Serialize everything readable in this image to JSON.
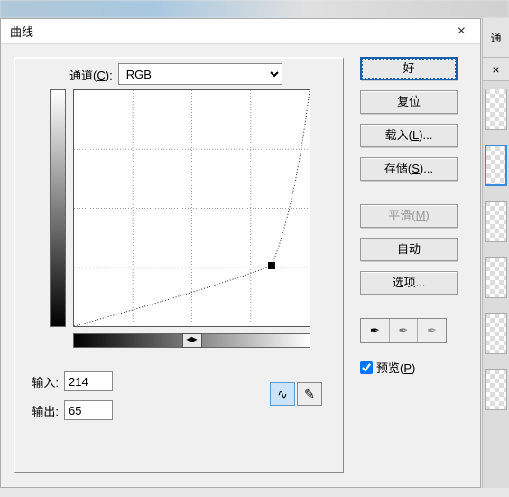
{
  "dialog": {
    "title": "曲线",
    "close_glyph": "×"
  },
  "channel": {
    "label_prefix": "通道(",
    "label_hotkey": "C",
    "label_suffix": "): ",
    "value": "RGB"
  },
  "chart_data": {
    "type": "line",
    "title": "",
    "xlabel": "输入",
    "ylabel": "输出",
    "xlim": [
      0,
      255
    ],
    "ylim": [
      0,
      255
    ],
    "points": [
      {
        "x": 0,
        "y": 0
      },
      {
        "x": 214,
        "y": 65
      },
      {
        "x": 255,
        "y": 255
      }
    ],
    "selected_point_index": 1,
    "grid_divisions": 4
  },
  "io": {
    "input_label": "输入:",
    "input_value": "214",
    "output_label": "输出:",
    "output_value": "65"
  },
  "mode": {
    "curve_glyph": "∿",
    "pencil_glyph": "✎"
  },
  "buttons": {
    "ok": "好",
    "reset": "复位",
    "load_prefix": "载入(",
    "load_hotkey": "L",
    "load_suffix": ")...",
    "save_prefix": "存储(",
    "save_hotkey": "S",
    "save_suffix": ")...",
    "smooth_prefix": "平滑(",
    "smooth_hotkey": "M",
    "smooth_suffix": ")",
    "auto": "自动",
    "options": "选项..."
  },
  "eyedropper": {
    "black": "✒",
    "gray": "✒",
    "white": "✒"
  },
  "preview": {
    "label_prefix": "预览(",
    "label_hotkey": "P",
    "label_suffix": ")",
    "checked": true
  },
  "hbar_handle_glyph": "◀▶",
  "bg_partial_btn": "通"
}
